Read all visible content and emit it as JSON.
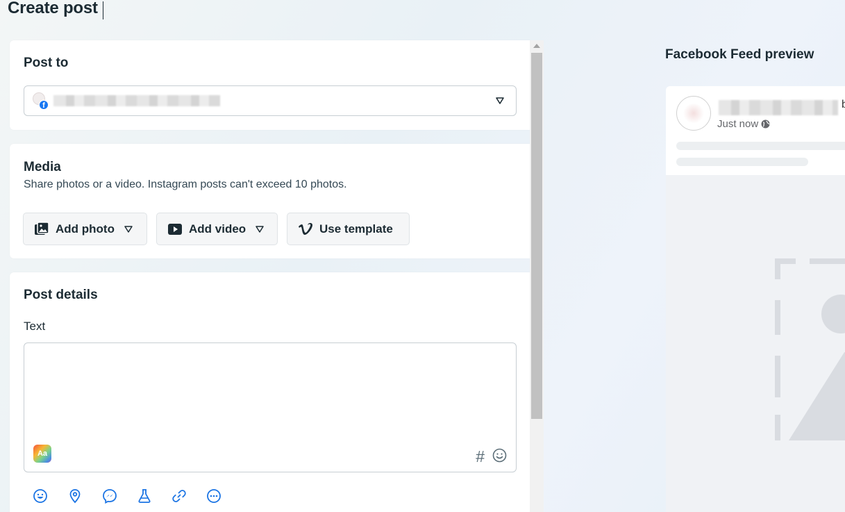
{
  "page": {
    "title": "Create post"
  },
  "post_to": {
    "heading": "Post to",
    "account_name": ""
  },
  "media": {
    "heading": "Media",
    "subtitle": "Share photos or a video. Instagram posts can't exceed 10 photos.",
    "buttons": {
      "add_photo": "Add photo",
      "add_video": "Add video",
      "use_template": "Use template"
    }
  },
  "post_details": {
    "heading": "Post details",
    "text_label": "Text",
    "text_value": "",
    "aa_label": "Aa",
    "hashtag_label": "#",
    "toolbar_icons": [
      "feeling-icon",
      "location-icon",
      "messenger-icon",
      "flask-icon",
      "link-icon",
      "more-icon"
    ]
  },
  "preview": {
    "title": "Facebook Feed preview",
    "name_suffix": "b",
    "timestamp": "Just now"
  },
  "colors": {
    "text": "#1c2b33",
    "accent_blue": "#1877f2",
    "icon_blue": "#1b74e4",
    "card_bg": "#ffffff",
    "preview_bg": "#f0f2f5"
  }
}
